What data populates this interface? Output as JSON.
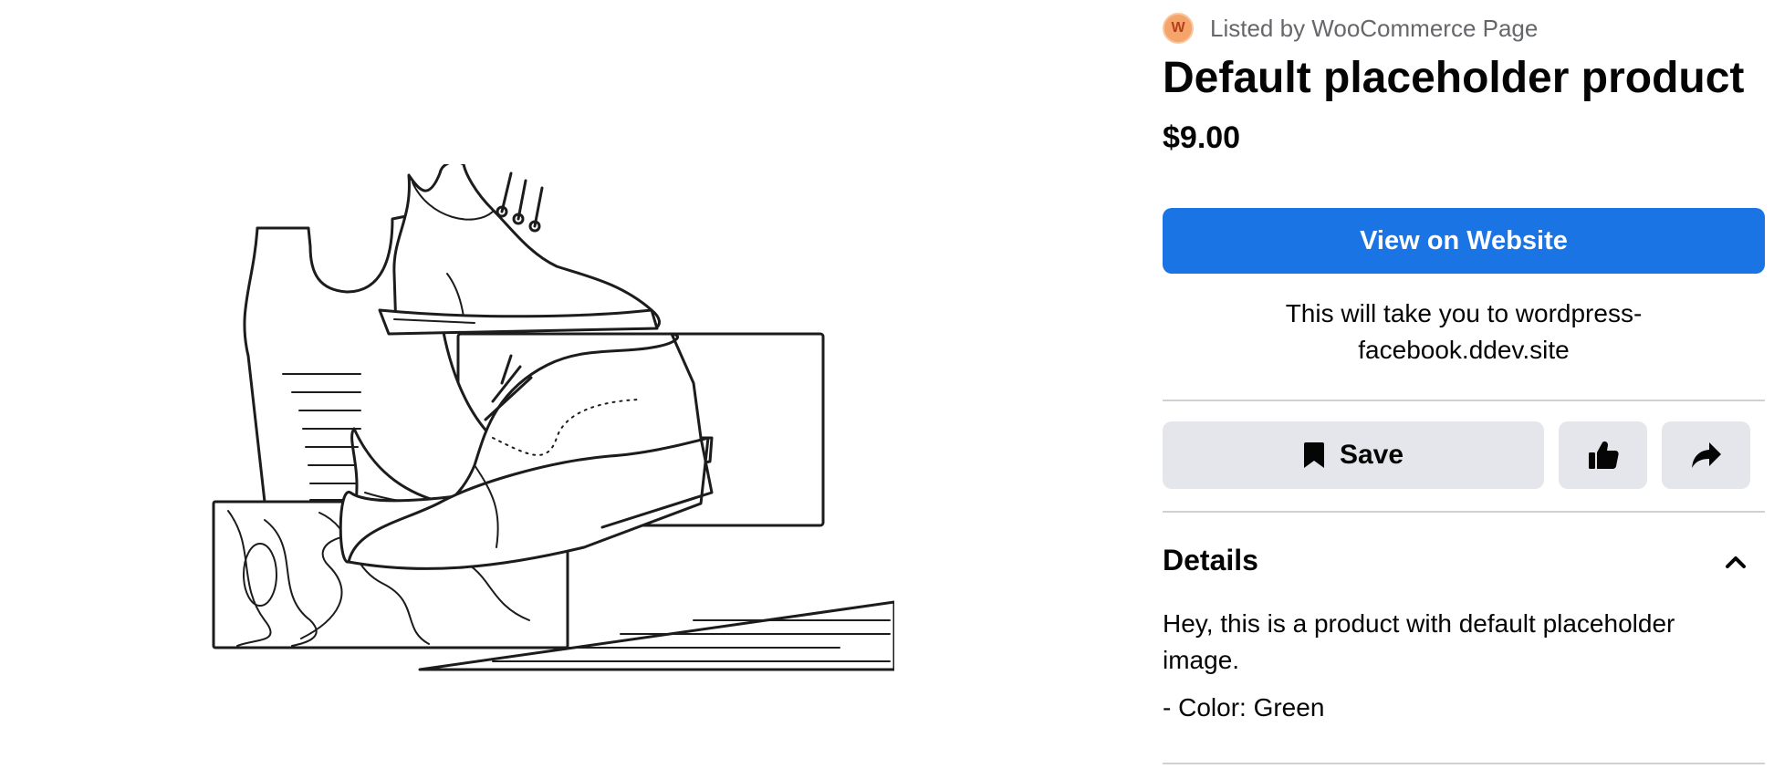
{
  "seller": {
    "avatar_initial": "W",
    "listed_by": "Listed by WooCommerce Page"
  },
  "product": {
    "title": "Default placeholder product",
    "price": "$9.00",
    "image_alt": "shoes-placeholder-illustration"
  },
  "cta": {
    "view_label": "View on Website",
    "redirect_note": "This will take you to wordpress-facebook.ddev.site"
  },
  "actions": {
    "save_label": "Save",
    "save_icon": "bookmark-icon",
    "like_icon": "thumbs-up-icon",
    "share_icon": "share-arrow-icon"
  },
  "details": {
    "heading": "Details",
    "toggle_icon": "chevron-up-icon",
    "description": "Hey, this is a product with default placeholder image.",
    "attribute": "- Color: Green"
  },
  "colors": {
    "primary": "#1b74e4",
    "secondary_button": "#e4e6eb",
    "avatar": "#f5a46b",
    "muted_text": "#65676b",
    "divider": "#ced0d4"
  }
}
